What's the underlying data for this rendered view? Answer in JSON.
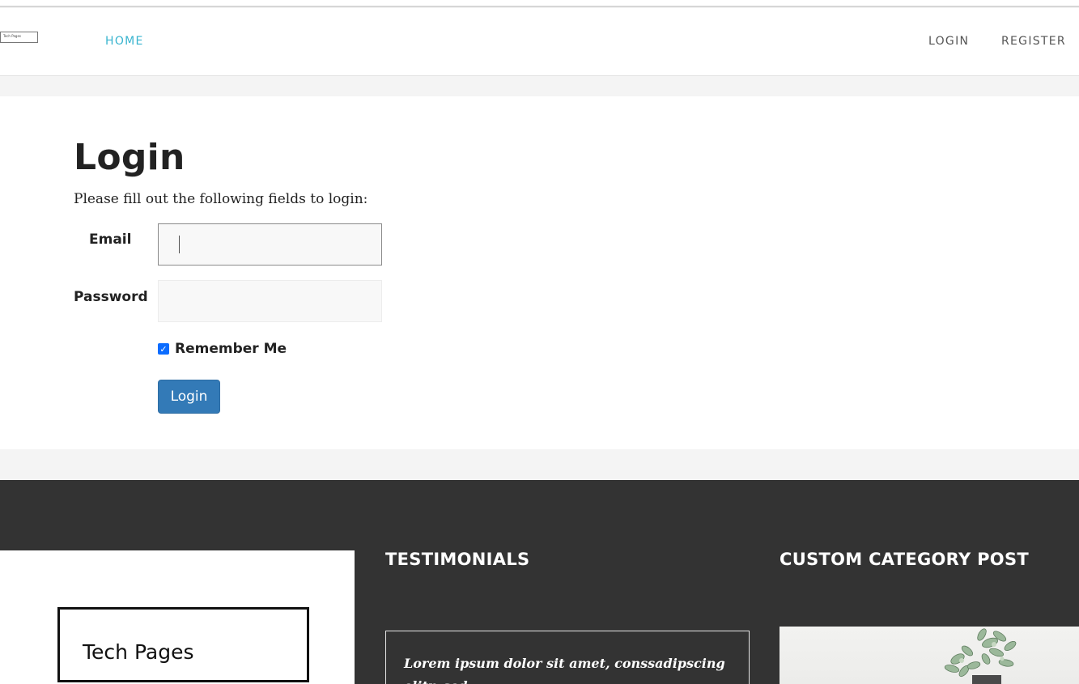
{
  "header": {
    "logo_text": "Tech Pages",
    "nav": {
      "home": "HOME",
      "login": "LOGIN",
      "register": "REGISTER"
    }
  },
  "main": {
    "title": "Login",
    "subtitle": "Please fill out the following fields to login:",
    "form": {
      "email_label": "Email",
      "email_value": "",
      "password_label": "Password",
      "password_value": "",
      "remember_label": "Remember Me",
      "remember_checked": true,
      "submit_label": "Login"
    }
  },
  "footer": {
    "logo_text": "Tech Pages",
    "testimonials_heading": "TESTIMONIALS",
    "testimonial_text": "Lorem ipsum dolor sit amet, conssadipscing elitr, sed",
    "custom_category_heading": "CUSTOM CATEGORY POST"
  },
  "colors": {
    "accent_nav": "#38b4cf",
    "button": "#337ab7",
    "footer_bg": "#333333"
  }
}
